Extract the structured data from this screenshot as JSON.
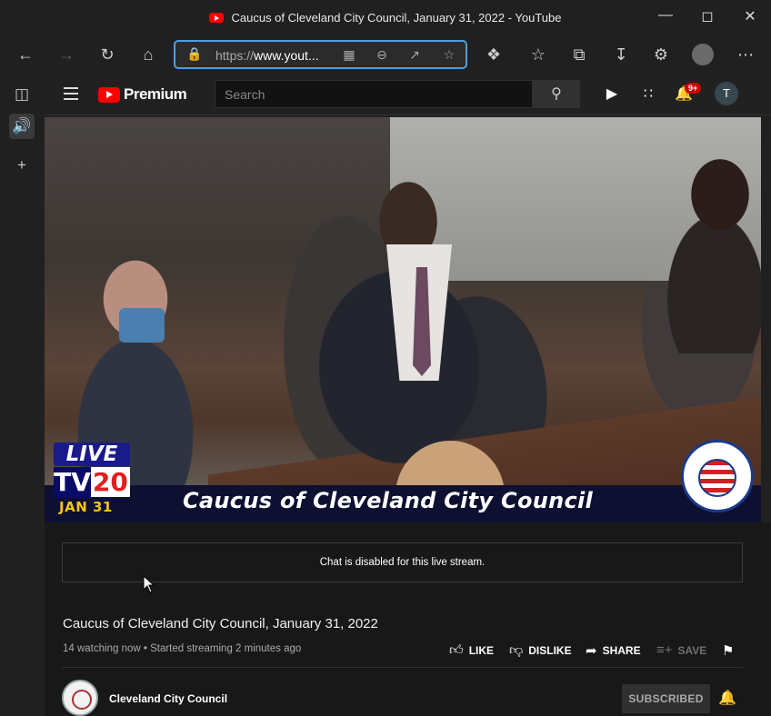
{
  "window": {
    "title": "Caucus of Cleveland City Council, January 31, 2022 - YouTube",
    "minimize_icon": "minimize-icon",
    "maximize_icon": "maximize-icon",
    "close_icon": "close-icon"
  },
  "browser": {
    "url_scheme": "https://",
    "url_host": "www.yout..."
  },
  "youtube": {
    "logo_text": "Premium",
    "search_placeholder": "Search",
    "notification_count": "9+",
    "avatar_letter": "T"
  },
  "video": {
    "live_text": "LIVE",
    "tv_text": "TV",
    "channel_number": "20",
    "date_text": "JAN 31",
    "lower_third": "Caucus of Cleveland City Council"
  },
  "chat": {
    "message": "Chat is disabled for this live stream."
  },
  "details": {
    "title": "Caucus of Cleveland City Council, January 31, 2022",
    "meta": "14 watching now • Started streaming 2 minutes ago",
    "like": "LIKE",
    "dislike": "DISLIKE",
    "share": "SHARE",
    "save": "SAVE"
  },
  "channel": {
    "name": "Cleveland City Council",
    "subscribe_label": "SUBSCRIBED"
  }
}
